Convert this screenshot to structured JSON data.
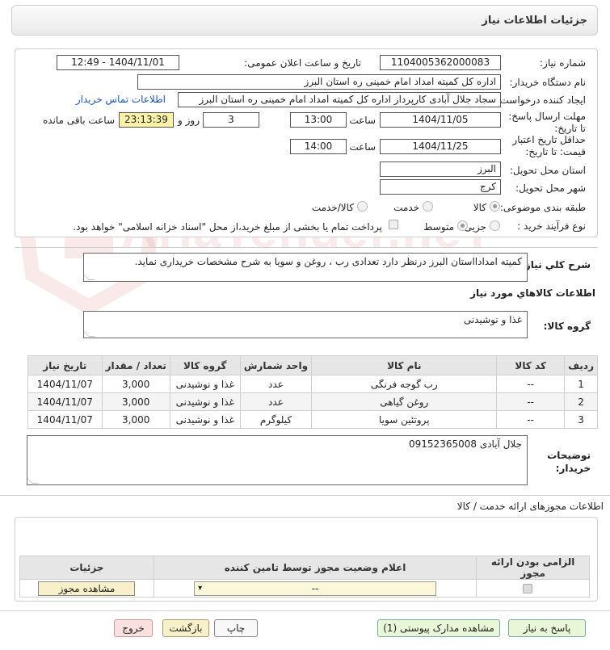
{
  "header": {
    "title": "جزئیات اطلاعات نیاز"
  },
  "form": {
    "need_number_label": "شماره نیاز:",
    "need_number": "1104005362000083",
    "announce_label": "تاریخ و ساعت اعلان عمومی:",
    "announce_value": "1404/11/01 - 12:49",
    "buyer_org_label": "نام دستگاه خریدار:",
    "buyer_org": "اداره کل کمیته امداد امام خمینی  ره  استان البرز",
    "creator_label": "ایجاد کننده درخواست:",
    "creator": "سجاد جلال آبادی کارپرداز اداره کل کمیته امداد امام خمینی  ره  استان البرز",
    "contact_link": "اطلاعات تماس خریدار",
    "reply_deadline_label": "مهلت ارسال پاسخ: تا تاریخ:",
    "reply_date": "1404/11/05",
    "time_label": "ساعت",
    "reply_time": "13:00",
    "days_value": "3",
    "days_label": "روز و",
    "remaining_time": "23:13:39",
    "remaining_label": "ساعت باقی مانده",
    "validity_label": "حداقل تاریخ اعتبار قیمت: تا تاریخ:",
    "validity_date": "1404/11/25",
    "validity_time": "14:00",
    "province_label": "استان محل تحویل:",
    "province": "البرز",
    "city_label": "شهر محل تحویل:",
    "city": "کرج",
    "category_label": "طبقه بندی موضوعی:",
    "category_options": [
      "کالا",
      "خدمت",
      "کالا/خدمت"
    ],
    "process_label": "نوع فرآیند خرید :",
    "process_options": [
      "جزیی",
      "متوسط"
    ],
    "payment_note": "پرداخت تمام یا بخشی از مبلغ خرید،از محل \"اسناد خزانه اسلامی\" خواهد بود."
  },
  "summary": {
    "label": "شرح کلي نياز:",
    "text": "کمیته امدادااستان البرز درنظر دارد تعدادی رب ، روغن و سویا به شرح مشخصات خریداری نماید."
  },
  "goods": {
    "section_title": "اطلاعات کالاهاي مورد نياز",
    "group_label": "گروه کالا:",
    "group_value": "غذا و نوشیدنی",
    "columns": [
      "ردیف",
      "کد کالا",
      "نام کالا",
      "واحد شمارش",
      "گروه کالا",
      "تعداد / مقدار",
      "تاریخ نیاز"
    ],
    "rows": [
      [
        "1",
        "--",
        "رب گوجه فرنگی",
        "عدد",
        "غذا و نوشیدنی",
        "3,000",
        "1404/11/07"
      ],
      [
        "2",
        "--",
        "روغن گیاهی",
        "عدد",
        "غذا و نوشیدنی",
        "3,000",
        "1404/11/07"
      ],
      [
        "3",
        "--",
        "پروتئین سویا",
        "کیلوگرم",
        "غذا و نوشیدنی",
        "3,000",
        "1404/11/07"
      ]
    ]
  },
  "buyer_notes": {
    "label": "توضیحات خریدار:",
    "text": "جلال آبادی 09152365008"
  },
  "permits": {
    "section_title": "اطلاعات مجوزهای ارائه خدمت / کالا",
    "columns": [
      "الزامی بودن ارائه مجوز",
      "اعلام وضعیت مجوز توسط تامین کننده",
      "جزئیات"
    ],
    "select_value": "--",
    "view_button": "مشاهده مجوز"
  },
  "footer": {
    "reply": "پاسخ به نیاز",
    "attachments": "مشاهده مدارک پیوستی (1)",
    "print": "چاپ",
    "back": "بازگشت",
    "exit": "خروج"
  },
  "watermark": {
    "text": "AriaTender.neT"
  }
}
